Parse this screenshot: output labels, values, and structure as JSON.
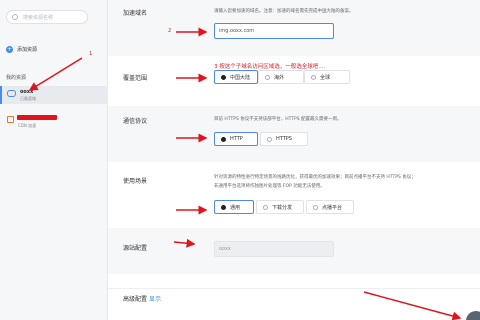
{
  "sidebar": {
    "search_placeholder": "搜索资源名称",
    "add_label": "添加资源",
    "section_title": "我的资源",
    "items": [
      {
        "name": "ooxx",
        "sub": "已备案域"
      },
      {
        "name": "",
        "sub": "CDN 加速"
      }
    ]
  },
  "form": {
    "domain": {
      "label": "加速域名",
      "desc": "请输入您要加速的域名。注意：加速的域名需先完成中国大陆的备案。",
      "value": "img.ooxx.com"
    },
    "coverage": {
      "label": "覆盖范围",
      "options": [
        "中国大陆",
        "海外",
        "全球"
      ],
      "selected": 0
    },
    "protocol": {
      "label": "通信协议",
      "desc": "目前 HTTPS 协议不支持该部平台，HTTPS 配置最久需要一周。",
      "options": [
        "HTTP",
        "HTTPS"
      ],
      "selected": 0
    },
    "scene": {
      "label": "使用场景",
      "desc1": "针对资源的特性进行特定场景的线路优化，获得最优的加速效果；目前点播平台不支持 HTTPS 协议；",
      "desc2": "非通用平台选项将作独图片处理等 FOP 功能无法使用。",
      "options": [
        "通用",
        "下载分发",
        "点播平台"
      ],
      "selected": 0
    },
    "origin": {
      "label": "源站配置",
      "value": "ooxx"
    },
    "advanced": {
      "label": "高级配置",
      "link": "显示"
    }
  },
  "annotations": {
    "num1": "1",
    "num2": "2",
    "note3": "3 按这个子域名访问区域选，一般选全球吧....",
    "color": "#e0141e"
  }
}
